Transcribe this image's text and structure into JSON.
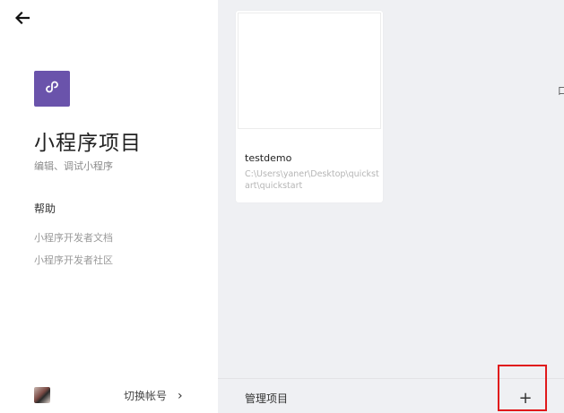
{
  "sidebar": {
    "back_icon": "arrow-left-icon",
    "app_icon": "mini-program-link-icon",
    "accent_color": "#6a53ab",
    "title": "小程序项目",
    "subtitle": "编辑、调试小程序",
    "help": {
      "heading": "帮助",
      "links": [
        "小程序开发者文档",
        "小程序开发者社区"
      ]
    },
    "footer": {
      "switch_account": "切换帐号",
      "chevron": "›"
    }
  },
  "main": {
    "projects": [
      {
        "name": "testdemo",
        "path": "C:\\Users\\yaner\\Desktop\\quickstart\\quickstart"
      }
    ],
    "manage_label": "管理项目",
    "add_label": "+",
    "edge_text": "口"
  }
}
